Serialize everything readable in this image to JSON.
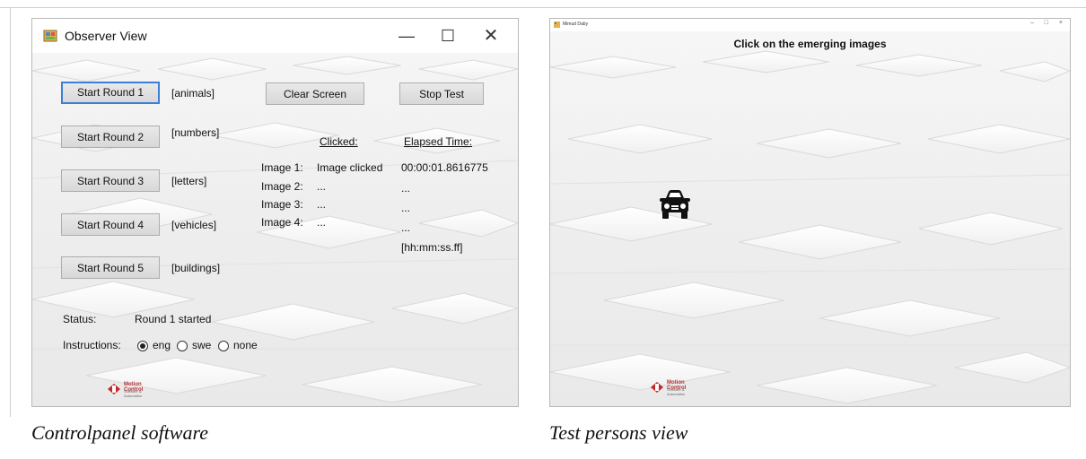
{
  "observer": {
    "title": "Observer View",
    "window_controls": {
      "minimize": "—",
      "maximize": "☐",
      "close": "✕"
    },
    "rounds": [
      {
        "button": "Start Round 1",
        "category": "[animals]"
      },
      {
        "button": "Start Round 2",
        "category": "[numbers]"
      },
      {
        "button": "Start Round 3",
        "category": "[letters]"
      },
      {
        "button": "Start Round 4",
        "category": "[vehicles]"
      },
      {
        "button": "Start Round 5",
        "category": "[buildings]"
      }
    ],
    "clear_button": "Clear Screen",
    "stop_button": "Stop Test",
    "clicked_header": "Clicked:",
    "elapsed_header": "Elapsed Time:",
    "images": [
      {
        "label": "Image 1:",
        "clicked": "Image clicked",
        "time": "00:00:01.8616775"
      },
      {
        "label": "Image 2:",
        "clicked": "...",
        "time": "..."
      },
      {
        "label": "Image 3:",
        "clicked": "...",
        "time": "..."
      },
      {
        "label": "Image 4:",
        "clicked": "...",
        "time": "..."
      }
    ],
    "time_format": "[hh:mm:ss.ff]",
    "status_label": "Status:",
    "status_value": "Round 1 started",
    "instructions_label": "Instructions:",
    "instruction_options": [
      {
        "label": "eng",
        "checked": true
      },
      {
        "label": "swe",
        "checked": false
      },
      {
        "label": "none",
        "checked": false
      }
    ],
    "logo_text": "Motion Control",
    "logo_subtext": "Software & Automation"
  },
  "test_view": {
    "title": "Mimud Daby",
    "window_controls": {
      "minimize": "–",
      "maximize": "□",
      "close": "×"
    },
    "instruction": "Click on the emerging images",
    "image_icon": "car-icon",
    "logo_text": "Motion Control",
    "logo_subtext": "Software & Automation"
  },
  "captions": {
    "left": "Controlpanel software",
    "right": "Test persons view"
  },
  "colors": {
    "focus_border": "#3c7fd8",
    "logo_red": "#c62828"
  }
}
